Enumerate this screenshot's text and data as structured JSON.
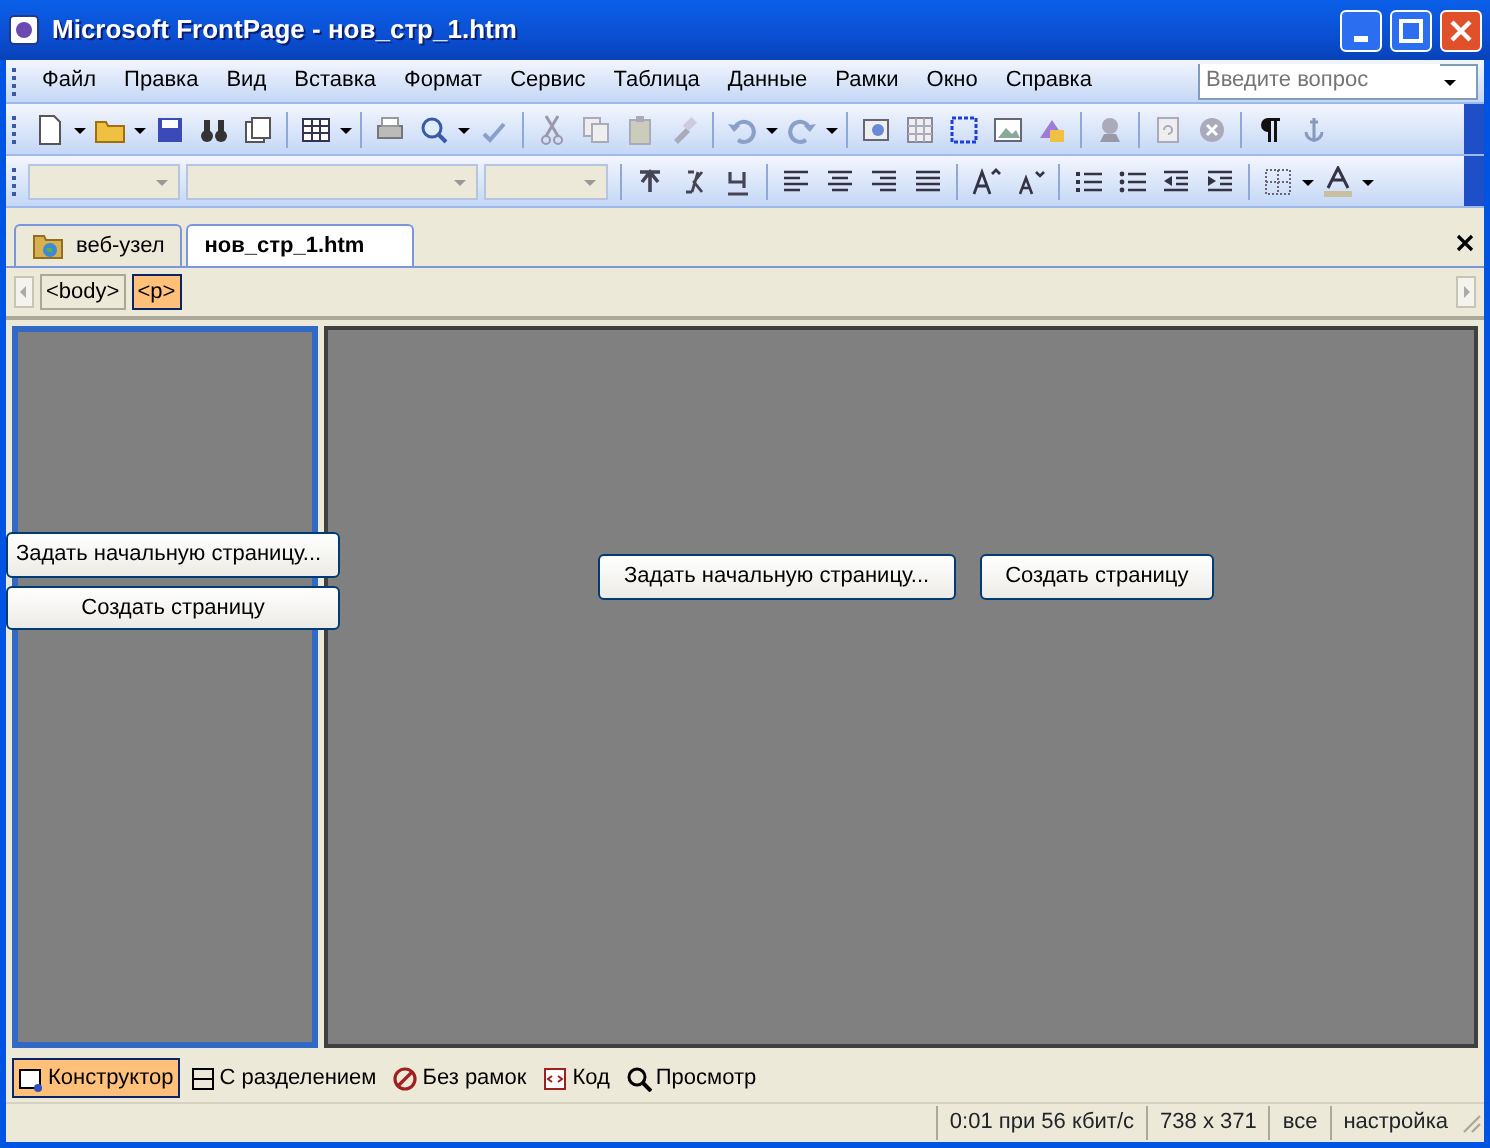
{
  "window": {
    "title": "Microsoft FrontPage - нов_стр_1.htm"
  },
  "menu": [
    {
      "label": "Файл"
    },
    {
      "label": "Правка"
    },
    {
      "label": "Вид"
    },
    {
      "label": "Вставка"
    },
    {
      "label": "Формат"
    },
    {
      "label": "Сервис"
    },
    {
      "label": "Таблица"
    },
    {
      "label": "Данные"
    },
    {
      "label": "Рамки"
    },
    {
      "label": "Окно"
    },
    {
      "label": "Справка"
    }
  ],
  "help_search": {
    "placeholder": "Введите вопрос"
  },
  "doc_tabs": [
    {
      "label": "веб-узел",
      "selected": false
    },
    {
      "label": "нов_стр_1.htm",
      "selected": true
    }
  ],
  "tag_path": [
    {
      "label": "<body>",
      "selected": false
    },
    {
      "label": "<p>",
      "selected": true
    }
  ],
  "frames": [
    {
      "selected": true,
      "buttons": [
        "Задать начальную страницу...",
        "Создать страницу"
      ]
    },
    {
      "selected": false,
      "buttons": [
        "Задать начальную страницу...",
        "Создать страницу"
      ]
    }
  ],
  "view_tabs": [
    {
      "label": "Конструктор",
      "selected": true
    },
    {
      "label": "С разделением",
      "selected": false
    },
    {
      "label": "Без рамок",
      "selected": false
    },
    {
      "label": "Код",
      "selected": false
    },
    {
      "label": "Просмотр",
      "selected": false
    }
  ],
  "status_bar": [
    "0:01 при 56 кбит/с",
    "738 x 371",
    "все",
    "настройка"
  ]
}
